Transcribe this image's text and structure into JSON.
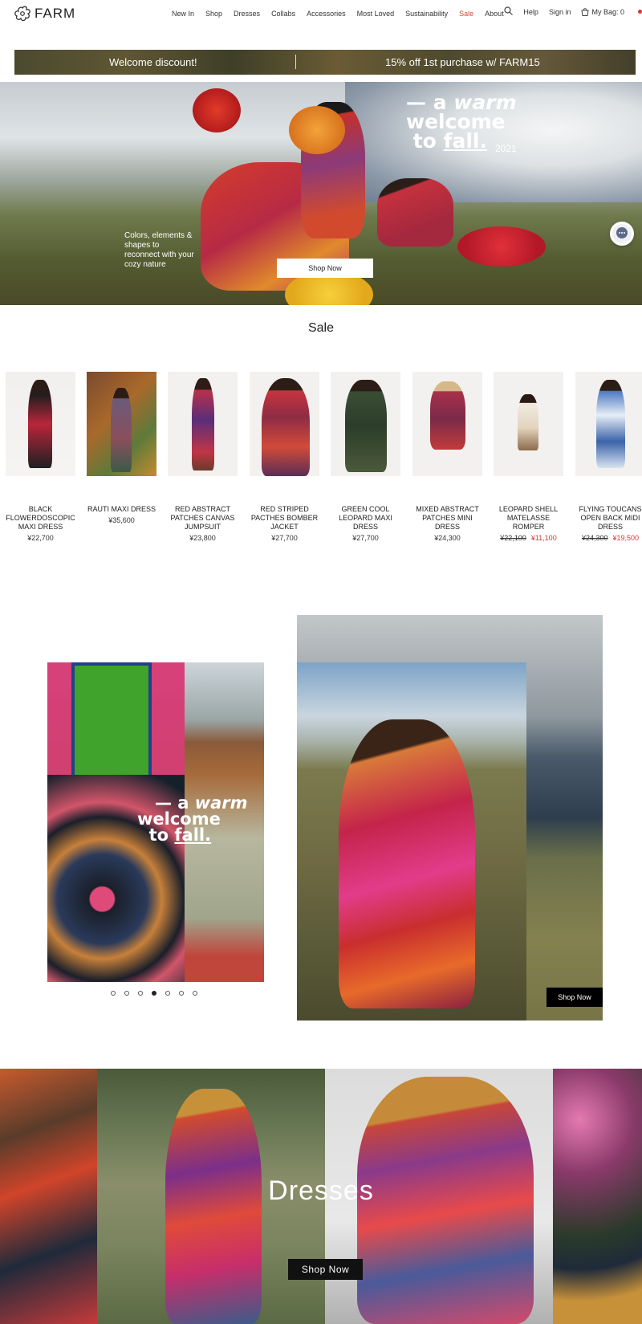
{
  "brand": {
    "name": "FARM",
    "logo_icon": "flower-icon"
  },
  "nav": {
    "items": [
      "New In",
      "Shop",
      "Dresses",
      "Collabs",
      "Accessories",
      "Most Loved",
      "Sustainability",
      "Sale",
      "About"
    ],
    "highlight_color": "#e0453d"
  },
  "utility": {
    "help": "Help",
    "signin": "Sign in",
    "bag": "My Bag: 0"
  },
  "promo": {
    "left": "Welcome discount!",
    "right": "15% off 1st purchase w/ FARM15"
  },
  "hero": {
    "title_dash": "— a",
    "title_accent": "warm",
    "title_line2": "welcome",
    "title_line3a": "to",
    "title_line3b": "fall.",
    "year": "2021",
    "subtitle": "Colors, elements & shapes to reconnect with your cozy nature",
    "button": "Shop Now"
  },
  "sale": {
    "title": "Sale",
    "products": [
      {
        "name": "BLACK FLOWERDOSCOPIC MAXI DRESS",
        "price": "¥22,700"
      },
      {
        "name": "RAUTI MAXI DRESS",
        "price": "¥35,600"
      },
      {
        "name": "RED ABSTRACT PATCHES CANVAS JUMPSUIT",
        "price": "¥23,800"
      },
      {
        "name": "RED STRIPED PACTHES BOMBER JACKET",
        "price": "¥27,700"
      },
      {
        "name": "GREEN COOL LEOPARD MAXI DRESS",
        "price": "¥27,700"
      },
      {
        "name": "MIXED ABSTRACT PATCHES MINI DRESS",
        "price": "¥24,300"
      },
      {
        "name": "LEOPARD SHELL MATELASSE ROMPER",
        "old_price": "¥22,100",
        "price": "¥11,100"
      },
      {
        "name": "FLYING TOUCANS OPEN BACK MIDI DRESS",
        "old_price": "¥24,300",
        "price": "¥19,500"
      }
    ]
  },
  "editorial": {
    "overlay_dash": "— a",
    "overlay_accent": "warm",
    "overlay_line2": "welcome",
    "overlay_line3a": "to",
    "overlay_line3b": "fall.",
    "carousel_dots": 7,
    "active_dot": 4,
    "button": "Shop Now"
  },
  "dresses": {
    "title": "Dresses",
    "button": "Shop Now"
  }
}
